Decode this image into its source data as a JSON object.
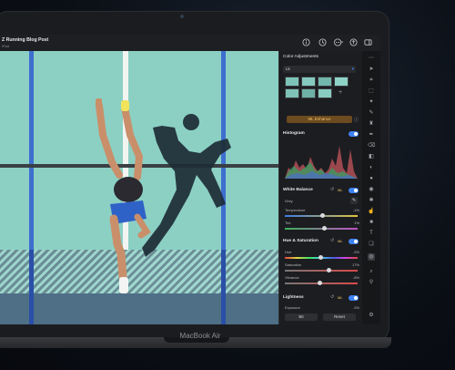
{
  "device": {
    "brand_label": "MacBook Air"
  },
  "document": {
    "title": "Z Running Blog Post",
    "subtitle": "iPad"
  },
  "toolbar_icons": [
    "info-icon",
    "clock-icon",
    "more-icon",
    "share-icon",
    "sidebar-icon"
  ],
  "panel": {
    "title": "Color Adjustments",
    "preset": "Lk",
    "ml_enhance": "ML Enhance",
    "histogram": {
      "label": "Histogram",
      "enabled": true
    },
    "white_balance": {
      "label": "White Balance",
      "badge": "ML",
      "enabled": true,
      "mode": "Grey",
      "rows": [
        {
          "label": "Temperature",
          "value": "-1%",
          "level": 0.49
        },
        {
          "label": "Tint",
          "value": "1%",
          "level": 0.51
        }
      ]
    },
    "hue_saturation": {
      "label": "Hue & Saturation",
      "badge": "ML",
      "enabled": true,
      "rows": [
        {
          "label": "Hue",
          "value": "-3%",
          "level": 0.47
        },
        {
          "label": "Saturation",
          "value": "17%",
          "level": 0.58
        },
        {
          "label": "Vibrance",
          "value": "-8%",
          "level": 0.46
        }
      ]
    },
    "lightness": {
      "label": "Lightness",
      "badge": "ML",
      "enabled": true,
      "rows": [
        {
          "label": "Exposure",
          "value": "-3%",
          "level": 0.48
        }
      ]
    },
    "footer": {
      "left_button": "Bit",
      "right_button": "Reset"
    }
  },
  "accent": "#3d82f4"
}
